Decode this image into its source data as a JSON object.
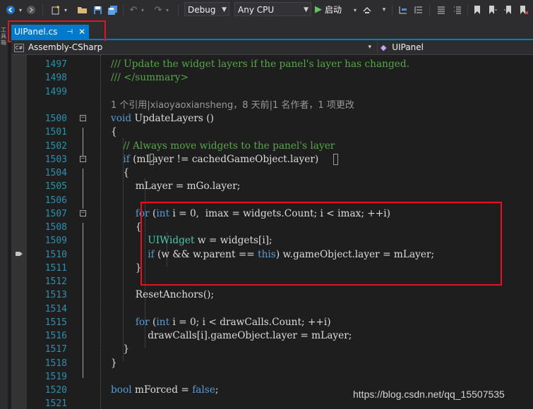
{
  "toolbar": {
    "configuration": "Debug",
    "platform": "Any CPU",
    "start_label": "启动",
    "icons": [
      "back-icon",
      "forward-icon",
      "new-project-icon",
      "open-folder-icon",
      "save-icon",
      "save-all-icon",
      "undo-icon",
      "redo-icon",
      "start-icon",
      "attach-icon",
      "step-over-icon",
      "comment-icon",
      "bookmark-icon"
    ]
  },
  "tab": {
    "title": "UIPanel.cs",
    "pin_glyph": "⊣",
    "close_glyph": "✕"
  },
  "left_strip": {
    "label": "工具箱"
  },
  "nav": {
    "project": "Assembly-CSharp",
    "type": "UIPanel"
  },
  "lines": [
    {
      "n": "1497",
      "code": [
        {
          "c": "cm",
          "t": "/// Update the widget layers if the panel's layer has changed."
        }
      ]
    },
    {
      "n": "1498",
      "code": [
        {
          "c": "cm",
          "t": "/// </summary>"
        }
      ]
    },
    {
      "n": "1499",
      "code": []
    },
    {
      "n": "",
      "lens": "1 个引用|xiaoyaoxiansheng，8 天前|1 名作者，1 项更改"
    },
    {
      "n": "1500",
      "code": [
        {
          "c": "kw",
          "t": "void"
        },
        {
          "c": "pl",
          "t": " UpdateLayers ()"
        }
      ]
    },
    {
      "n": "1501",
      "code": [
        {
          "c": "pl",
          "t": "{"
        }
      ]
    },
    {
      "n": "1502",
      "code": [
        {
          "c": "pl",
          "t": "    "
        },
        {
          "c": "cm",
          "t": "// Always move widgets to the panel's layer"
        }
      ]
    },
    {
      "n": "1503",
      "code": [
        {
          "c": "pl",
          "t": "    "
        },
        {
          "c": "kw",
          "t": "if"
        },
        {
          "c": "pl",
          "t": " (mLayer != cachedGameObject.layer)"
        }
      ]
    },
    {
      "n": "1504",
      "code": [
        {
          "c": "pl",
          "t": "    {"
        }
      ]
    },
    {
      "n": "1505",
      "code": [
        {
          "c": "pl",
          "t": "        mLayer = mGo.layer;"
        }
      ]
    },
    {
      "n": "1506",
      "code": []
    },
    {
      "n": "1507",
      "code": [
        {
          "c": "pl",
          "t": "        "
        },
        {
          "c": "kw",
          "t": "for"
        },
        {
          "c": "pl",
          "t": " ("
        },
        {
          "c": "kw",
          "t": "int"
        },
        {
          "c": "pl",
          "t": " i = 0,  imax = widgets.Count; i < imax; ++i)"
        }
      ]
    },
    {
      "n": "1508",
      "code": [
        {
          "c": "pl",
          "t": "        {"
        }
      ]
    },
    {
      "n": "1509",
      "code": [
        {
          "c": "pl",
          "t": "            "
        },
        {
          "c": "ty",
          "t": "UIWidget"
        },
        {
          "c": "pl",
          "t": " w = widgets[i];"
        }
      ]
    },
    {
      "n": "1510",
      "code": [
        {
          "c": "pl",
          "t": "            "
        },
        {
          "c": "kw",
          "t": "if"
        },
        {
          "c": "pl",
          "t": " (w && w.parent == "
        },
        {
          "c": "kw",
          "t": "this"
        },
        {
          "c": "pl",
          "t": ") w.gameObject.layer = mLayer;"
        }
      ]
    },
    {
      "n": "1511",
      "code": [
        {
          "c": "pl",
          "t": "        }"
        }
      ]
    },
    {
      "n": "1512",
      "code": []
    },
    {
      "n": "1513",
      "code": [
        {
          "c": "pl",
          "t": "        ResetAnchors();"
        }
      ]
    },
    {
      "n": "1514",
      "code": []
    },
    {
      "n": "1515",
      "code": [
        {
          "c": "pl",
          "t": "        "
        },
        {
          "c": "kw",
          "t": "for"
        },
        {
          "c": "pl",
          "t": " ("
        },
        {
          "c": "kw",
          "t": "int"
        },
        {
          "c": "pl",
          "t": " i = 0; i < drawCalls.Count; ++i)"
        }
      ]
    },
    {
      "n": "1516",
      "code": [
        {
          "c": "pl",
          "t": "            drawCalls[i].gameObject.layer = mLayer;"
        }
      ]
    },
    {
      "n": "1517",
      "code": [
        {
          "c": "pl",
          "t": "    }"
        }
      ]
    },
    {
      "n": "1518",
      "code": [
        {
          "c": "pl",
          "t": "}"
        }
      ]
    },
    {
      "n": "1519",
      "code": []
    },
    {
      "n": "1520",
      "code": [
        {
          "c": "kw",
          "t": "bool"
        },
        {
          "c": "pl",
          "t": " mForced = "
        },
        {
          "c": "kw",
          "t": "false"
        },
        {
          "c": "pl",
          "t": ";"
        }
      ]
    },
    {
      "n": "1521",
      "code": []
    }
  ],
  "colors": {
    "accent": "#007acc",
    "highlight": "#e81123",
    "keyword": "#569cd6",
    "comment": "#57a64a",
    "type": "#4ec9b0",
    "line_number": "#2b91af"
  },
  "watermark": "https://blog.csdn.net/qq_15507535"
}
